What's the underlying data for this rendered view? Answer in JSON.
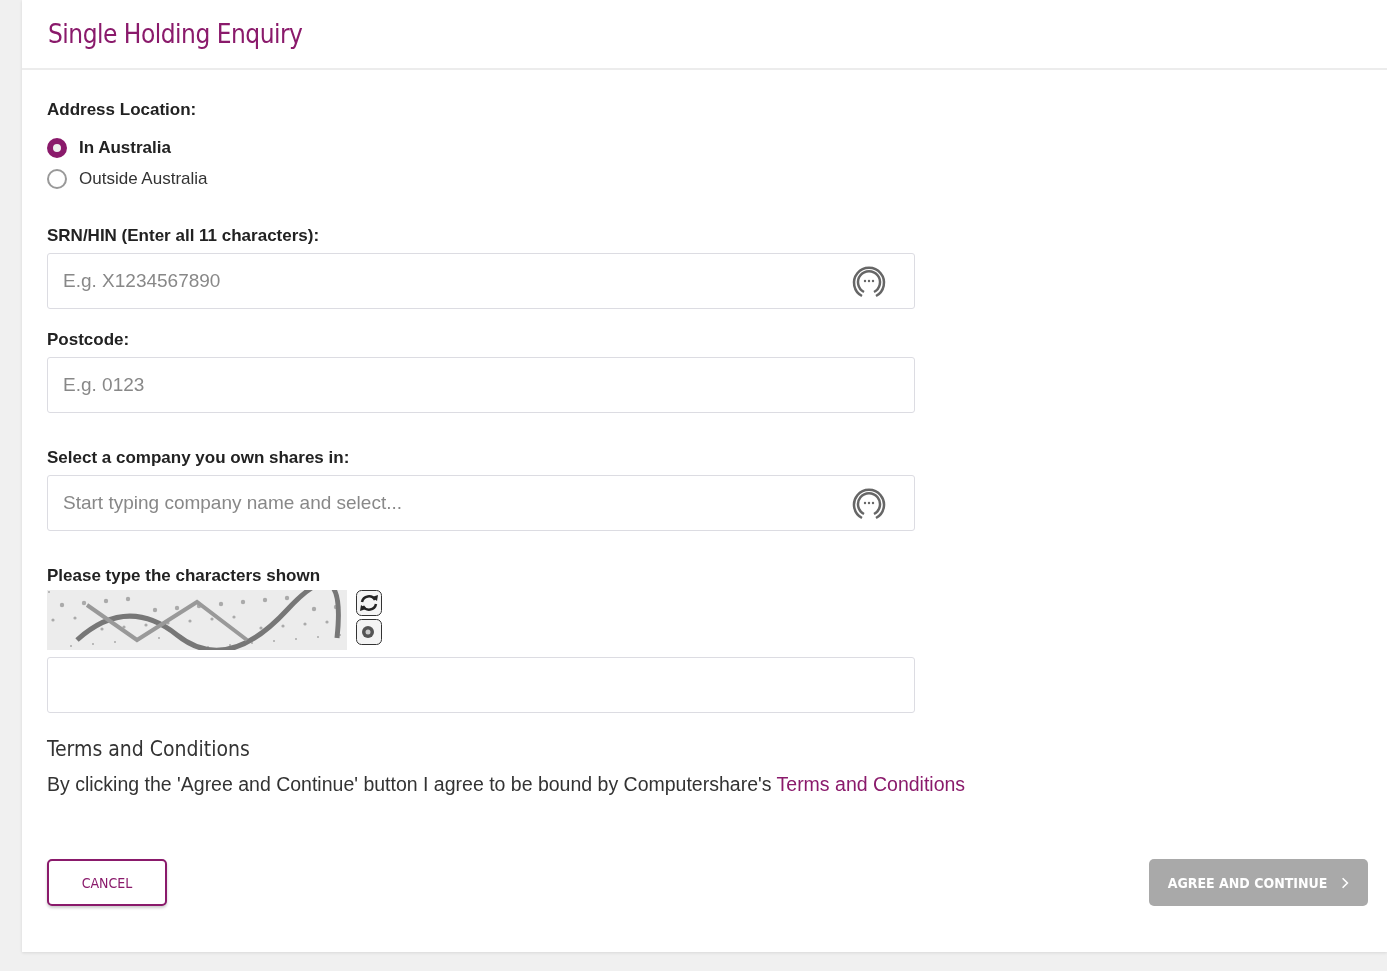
{
  "title": "Single Holding Enquiry",
  "address": {
    "label": "Address Location:",
    "options": [
      {
        "label": "In Australia",
        "selected": true
      },
      {
        "label": "Outside Australia",
        "selected": false
      }
    ]
  },
  "fields": [
    {
      "label": "SRN/HIN (Enter all 11 characters):",
      "placeholder": "E.g. X1234567890",
      "masked_icon": true
    },
    {
      "label": "Postcode:",
      "placeholder": "E.g. 0123",
      "masked_icon": false
    },
    {
      "label": "Select a company you own shares in:",
      "placeholder": "Start typing company name and select...",
      "masked_icon": true
    }
  ],
  "captcha": {
    "label": "Please type the characters shown"
  },
  "terms": {
    "heading": "Terms and Conditions",
    "text": "By clicking the 'Agree and Continue' button I agree to be bound by Computershare's ",
    "link": "Terms and Conditions"
  },
  "buttons": {
    "cancel": {
      "label": "CANCEL"
    },
    "agree": {
      "label": "AGREE AND CONTINUE",
      "disabled": true
    }
  }
}
